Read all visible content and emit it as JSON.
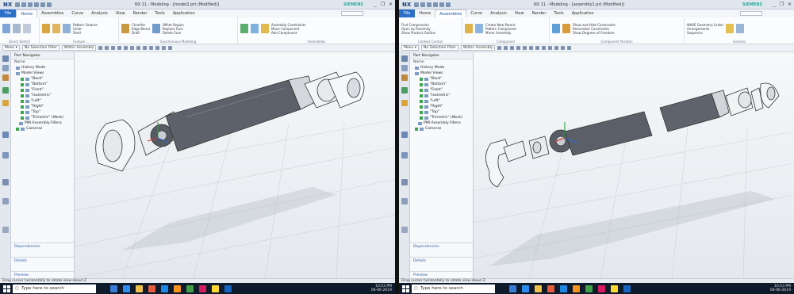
{
  "app": {
    "logo": "NX",
    "left_window_title": "NX 11 - Modeling - [model2.prt (Modified)]",
    "right_window_title": "NX 11 - Modeling - [assembly1.prt (Modified)]",
    "brand": "SIEMENS",
    "window_controls": [
      "_",
      "❐",
      "✕"
    ]
  },
  "menu": {
    "file": "File",
    "tabs": [
      "Home",
      "Assemblies",
      "Curve",
      "Analysis",
      "View",
      "Render",
      "Tools",
      "Application"
    ]
  },
  "ribbon_left": {
    "groups": [
      {
        "label": "Direct Sketch",
        "items": [
          "Sketch",
          "Line",
          "Arc"
        ]
      },
      {
        "label": "Feature",
        "items": [
          "Extrude",
          "Revolve",
          "Hole",
          "Pattern Feature",
          "Unite",
          "Shell"
        ]
      },
      {
        "label": "Synchronous Modeling",
        "items": [
          "Chamfer",
          "Edge Blend",
          "Draft",
          "Offset Region",
          "Replace Face",
          "Delete Face"
        ]
      },
      {
        "label": "Assemblies",
        "items": [
          "Move",
          "Pattern",
          "Assembly Constraints",
          "Move Component",
          "Add Component"
        ]
      }
    ]
  },
  "ribbon_right": {
    "groups": [
      {
        "label": "Context Control",
        "items": [
          "Find Components",
          "Open by Proximity",
          "Show Product Outline"
        ]
      },
      {
        "label": "Component",
        "items": [
          "Add",
          "New",
          "Create New Parent",
          "Pattern Component",
          "Mirror Assembly"
        ]
      },
      {
        "label": "Component Position",
        "items": [
          "Move Component",
          "Assembly Constraints",
          "Show and Hide Constraints",
          "Remember Constraints",
          "Show Degrees of Freedom"
        ]
      },
      {
        "label": "General",
        "items": [
          "WAVE Geometry Linker",
          "Arrangements",
          "Sequence",
          "Exploded Views",
          "Clearance Analysis"
        ]
      }
    ]
  },
  "selbar": {
    "menu": "Menu ▾",
    "filter": "No Selection Filter",
    "scope": "Within Assembly"
  },
  "navigator": {
    "title": "Part Navigator",
    "column": "Name",
    "items": [
      "History Mode",
      "Model Views",
      "\"Back\"",
      "\"Bottom\"",
      "\"Front\"",
      "\"Isometric\"",
      "\"Left\"",
      "\"Right\"",
      "\"Top\"",
      "\"Trimetric\" (Work)",
      "PMI Assembly Filters",
      "Cameras"
    ],
    "footer": [
      "Dependencies",
      "Details",
      "Preview"
    ]
  },
  "cue_line": "Drag cursor horizontally to rotate view about Z",
  "taskbar": {
    "search_placeholder": "Type here to search",
    "time": "10:53 PM",
    "date": "06-06-2019",
    "lang": "ENG"
  }
}
